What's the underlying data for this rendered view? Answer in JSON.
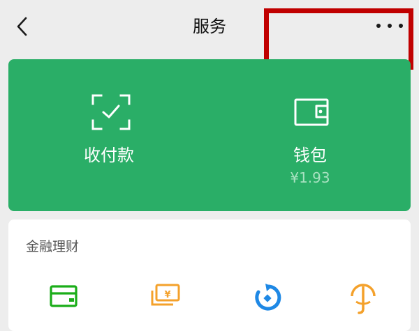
{
  "header": {
    "title": "服务",
    "back_icon": "chevron-left-icon",
    "more_icon": "more-horizontal-icon"
  },
  "colors": {
    "page_bg": "#ededed",
    "wallet_card_bg": "#2aae67",
    "highlight_border": "#c00000",
    "wealth_green": "#1aad19",
    "wealth_orange": "#f4a12b",
    "wealth_blue": "#1e88e5"
  },
  "wallet_card": {
    "pay": {
      "label": "收付款",
      "icon": "scan-check-icon"
    },
    "wallet": {
      "label": "钱包",
      "balance": "¥1.93",
      "icon": "wallet-icon"
    }
  },
  "finance_section": {
    "title": "金融理财",
    "items": [
      {
        "icon": "credit-card-icon"
      },
      {
        "icon": "yuan-bills-icon"
      },
      {
        "icon": "wealth-refresh-icon"
      },
      {
        "icon": "insurance-umbrella-icon"
      }
    ]
  }
}
